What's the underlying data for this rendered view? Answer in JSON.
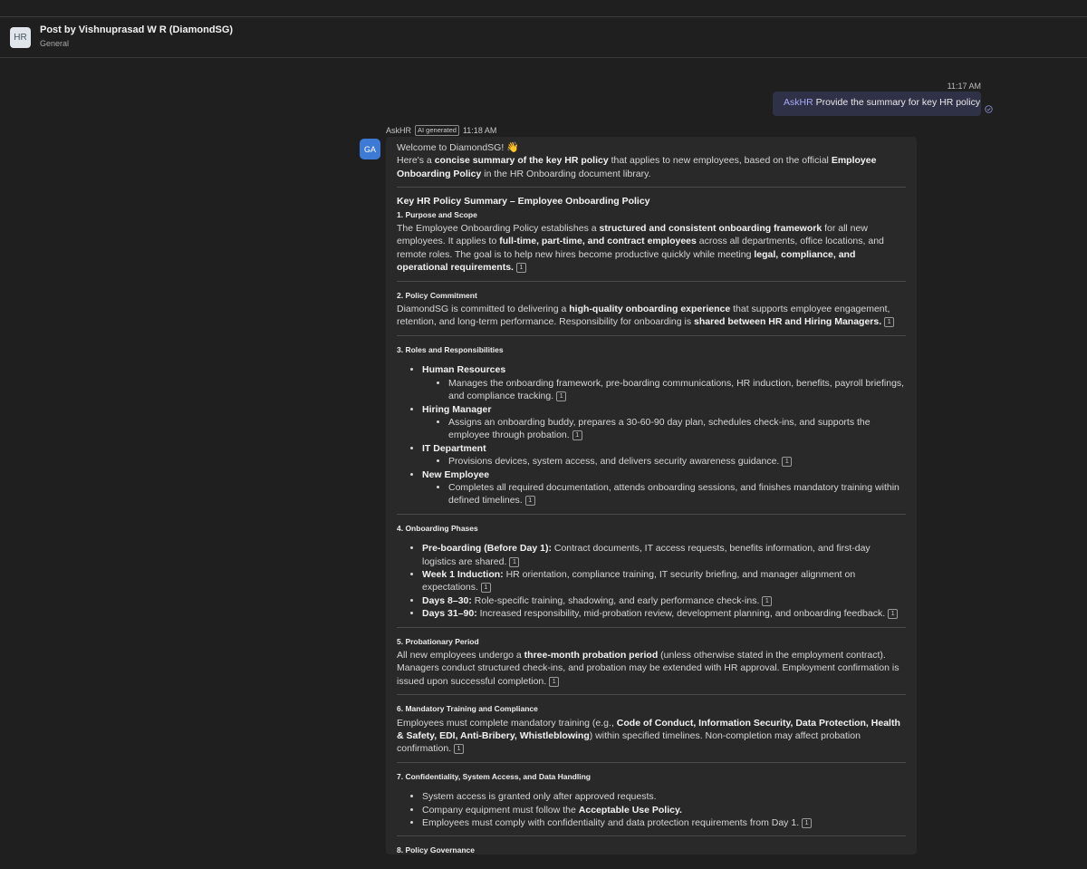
{
  "header": {
    "avatar": "HR",
    "title": "Post by Vishnuprasad W R (DiamondSG)",
    "channel": "General"
  },
  "outgoing": {
    "time": "11:17 AM",
    "mention": "AskHR",
    "text": " Provide the summary for key HR policy",
    "status_icon": "check-circle-icon"
  },
  "reply": {
    "sender": "AskHR",
    "badge": "AI generated",
    "time": "11:18 AM",
    "avatar": "GA",
    "greeting": "Welcome to DiamondSG! ",
    "wave_emoji": "👋",
    "intro_1": "Here's a ",
    "intro_b1": "concise summary of the key HR policy",
    "intro_2": " that applies to new employees, based on the official ",
    "intro_b2": "Employee Onboarding Policy",
    "intro_3": " in the HR Onboarding document library.",
    "summary_title": "Key HR Policy Summary – Employee Onboarding Policy",
    "cite": "1",
    "s1": {
      "title": "1. Purpose and Scope",
      "t1": "The Employee Onboarding Policy establishes a ",
      "b1": "structured and consistent onboarding framework",
      "t2": " for all new employees. It applies to ",
      "b2": "full-time, part-time, and contract employees",
      "t3": " across all departments, office locations, and remote roles. The goal is to help new hires become productive quickly while meeting ",
      "b3": "legal, compliance, and operational requirements."
    },
    "s2": {
      "title": "2. Policy Commitment",
      "t1": "DiamondSG is committed to delivering a ",
      "b1": "high-quality onboarding experience",
      "t2": " that supports employee engagement, retention, and long-term performance. Responsibility for onboarding is ",
      "b2": "shared between HR and Hiring Managers."
    },
    "s3": {
      "title": "3. Roles and Responsibilities",
      "roles": [
        {
          "role": "Human Resources",
          "desc": "Manages the onboarding framework, pre-boarding communications, HR induction, benefits, payroll briefings, and compliance tracking."
        },
        {
          "role": "Hiring Manager",
          "desc": "Assigns an onboarding buddy, prepares a 30-60-90 day plan, schedules check-ins, and supports the employee through probation."
        },
        {
          "role": "IT Department",
          "desc": "Provisions devices, system access, and delivers security awareness guidance."
        },
        {
          "role": "New Employee",
          "desc": "Completes all required documentation, attends onboarding sessions, and finishes mandatory training within defined timelines."
        }
      ]
    },
    "s4": {
      "title": "4. Onboarding Phases",
      "phases": [
        {
          "label": "Pre-boarding (Before Day 1):",
          "desc": " Contract documents, IT access requests, benefits information, and first-day logistics are shared."
        },
        {
          "label": "Week 1 Induction:",
          "desc": " HR orientation, compliance training, IT security briefing, and manager alignment on expectations."
        },
        {
          "label": "Days 8–30:",
          "desc": " Role-specific training, shadowing, and early performance check-ins."
        },
        {
          "label": "Days 31–90:",
          "desc": " Increased responsibility, mid-probation review, development planning, and onboarding feedback."
        }
      ]
    },
    "s5": {
      "title": "5. Probationary Period",
      "t1": "All new employees undergo a ",
      "b1": "three-month probation period",
      "t2": " (unless otherwise stated in the employment contract). Managers conduct structured check-ins, and probation may be extended with HR approval. Employment confirmation is issued upon successful completion."
    },
    "s6": {
      "title": "6. Mandatory Training and Compliance",
      "t1": "Employees must complete mandatory training (e.g., ",
      "b1": "Code of Conduct, Information Security, Data Protection, Health & Safety, EDI, Anti-Bribery, Whistleblowing",
      "t2": ") within specified timelines. Non-completion may affect probation confirmation."
    },
    "s7": {
      "title": "7. Confidentiality, System Access, and Data Handling",
      "i1": "System access is granted only after approved requests.",
      "i2_t": "Company equipment must follow the ",
      "i2_b": "Acceptable Use Policy.",
      "i3": "Employees must comply with confidentiality and data protection requirements from Day 1."
    },
    "s8": {
      "title": "8. Policy Governance"
    }
  }
}
